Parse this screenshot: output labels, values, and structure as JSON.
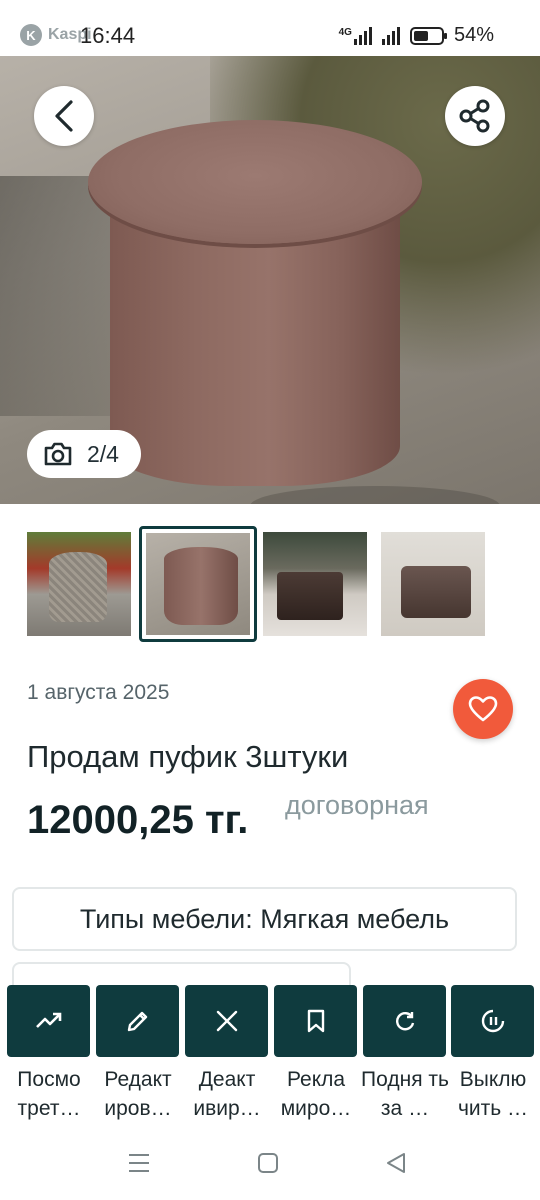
{
  "status_bar": {
    "app_logo_text": "K",
    "app_name": "Kaspi",
    "time": "16:44",
    "network": "4G",
    "battery_percent": "54%",
    "battery_level": 0.54
  },
  "gallery": {
    "counter": "2/4",
    "thumbnails": [
      {
        "name": "thumb-1",
        "active": false
      },
      {
        "name": "thumb-2",
        "active": true
      },
      {
        "name": "thumb-3",
        "active": false
      },
      {
        "name": "thumb-4",
        "active": false
      }
    ]
  },
  "listing": {
    "date": "1 августа 2025",
    "title": "Продам пуфик 3штуки",
    "price": "12000,25 тг.",
    "negotiable": "договорная",
    "category_chip": "Типы мебели: Мягкая мебель"
  },
  "actions": [
    {
      "icon": "trend-up-icon",
      "label": "Посмо трет…"
    },
    {
      "icon": "pencil-icon",
      "label": "Редакт иров…"
    },
    {
      "icon": "close-icon",
      "label": "Деакт ивир…"
    },
    {
      "icon": "bookmark-icon",
      "label": "Рекла миро…"
    },
    {
      "icon": "refresh-icon",
      "label": "Подня ть за …"
    },
    {
      "icon": "pause-icon",
      "label": "Выклю чить …"
    }
  ],
  "colors": {
    "primary_dark": "#0f3b3e",
    "favorite_orange": "#f15a3b",
    "secondary_text": "#8b9a9e"
  }
}
